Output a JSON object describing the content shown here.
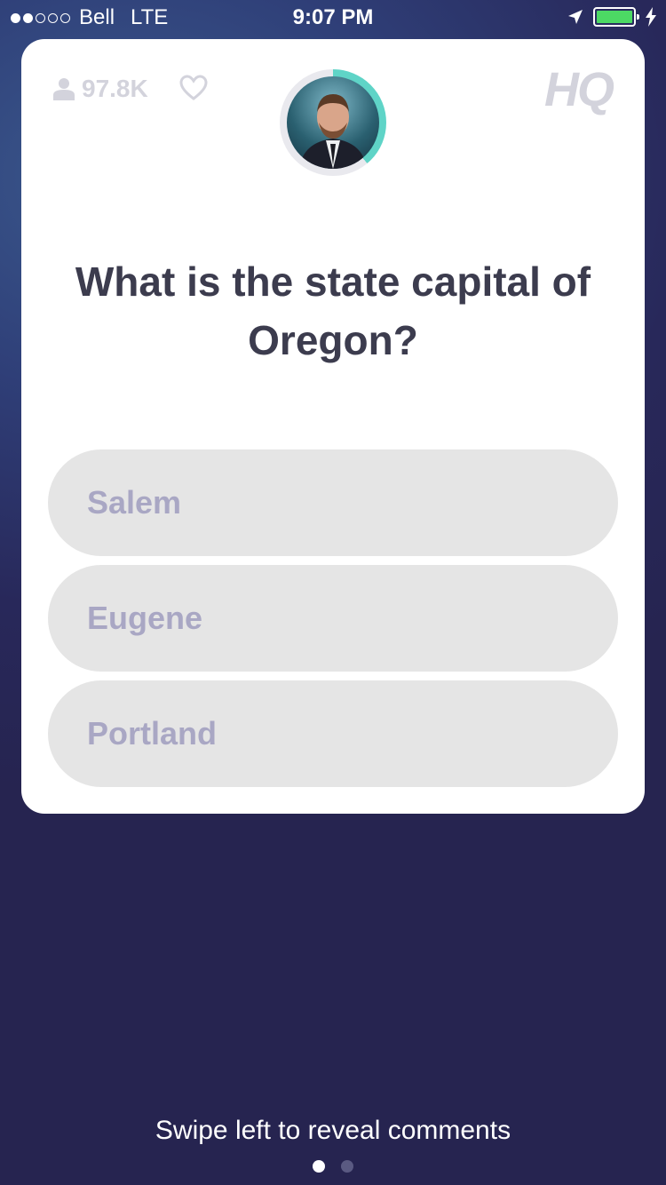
{
  "status_bar": {
    "carrier": "Bell",
    "network": "LTE",
    "time": "9:07 PM",
    "signal_bars_filled": 2,
    "signal_bars_total": 5,
    "battery_color": "#4cd964"
  },
  "card": {
    "viewer_count": "97.8K",
    "logo": "HQ",
    "host_timer_color": "#5fd4c7",
    "question": "What is the state capital of Oregon?",
    "answers": [
      {
        "label": "Salem"
      },
      {
        "label": "Eugene"
      },
      {
        "label": "Portland"
      }
    ]
  },
  "footer": {
    "hint": "Swipe left to reveal comments",
    "page_count": 2,
    "active_page": 1
  },
  "icons": [
    "person-icon",
    "heart-icon",
    "location-arrow-icon",
    "battery-icon",
    "charging-bolt-icon"
  ]
}
